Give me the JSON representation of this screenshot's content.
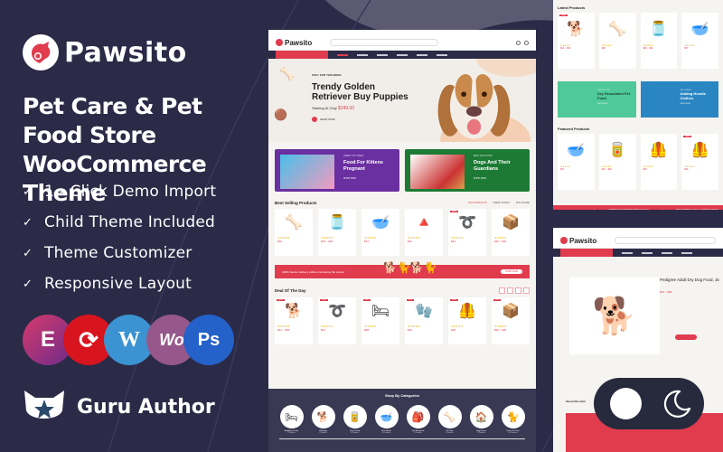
{
  "brand": {
    "name": "Pawsito",
    "logo_icon": "dog-cat-logo-icon"
  },
  "headline": {
    "line1": "Pet Care & Pet Food Store",
    "line2": "WooCommerce Theme"
  },
  "features": [
    "1 - Click Demo Import",
    "Child Theme Included",
    "Theme Customizer",
    "Responsive Layout"
  ],
  "badges": [
    {
      "name": "elementor",
      "glyph": "E",
      "color": "#92003b"
    },
    {
      "name": "revolution-slider",
      "glyph": "⟳",
      "color": "#e20a16"
    },
    {
      "name": "wordpress",
      "glyph": "W",
      "color": "#3b93d1"
    },
    {
      "name": "woocommerce",
      "glyph": "Wo",
      "color": "#96588a"
    },
    {
      "name": "photoshop",
      "glyph": "Ps",
      "color": "#2461c9"
    }
  ],
  "author": {
    "label": "Guru Author"
  },
  "mockup": {
    "logo": "Pawsito",
    "hero": {
      "kicker": "ONLY FOR THIS WEEK",
      "title": "Trendy Golden Retriever Buy Puppies",
      "price_label": "Starting At Only",
      "price": "$249.00",
      "button": "SHOP NOW"
    },
    "promos": [
      {
        "kicker": "GREAT CAT TREAT",
        "title": "Food For Kittens Pregnant",
        "button": "SHOP NOW",
        "color": "#6a2fa0"
      },
      {
        "kicker": "BEST DOG FOOD",
        "title": "Dogs And Their Guardians",
        "button": "SHOP NOW",
        "color": "#1d7a34"
      }
    ],
    "best_selling": {
      "title": "Best Selling Products",
      "tabs": [
        "DOG PRODUCTS",
        "FRESH FOODS",
        "DOG HOUSE"
      ],
      "products": [
        {
          "icon": "🦴",
          "price": "$30"
        },
        {
          "icon": "🫙",
          "price": "$25 – $30"
        },
        {
          "icon": "🥣",
          "price": "$37"
        },
        {
          "icon": "🔺",
          "price": "$42"
        },
        {
          "icon": "➰",
          "price": "$22",
          "sale": "SALE"
        },
        {
          "icon": "📦",
          "price": "$32 – $40"
        }
      ]
    },
    "strip": {
      "text": "100% Secure delivery without contacting the courier",
      "button": "SHOP NOW"
    },
    "deal": {
      "title": "Deal Of The Day",
      "products": [
        {
          "icon": "🐕",
          "price": "$12 – $30",
          "sale": "-10%"
        },
        {
          "icon": "➰",
          "price": "$22",
          "sale": "-15%"
        },
        {
          "icon": "🛏",
          "price": "$28",
          "sale": "-8%"
        },
        {
          "icon": "🧤",
          "price": "$19",
          "sale": "-5%"
        },
        {
          "icon": "🦺",
          "price": "$48",
          "sale": "-10%"
        },
        {
          "icon": "📦",
          "price": "$20 – $30",
          "sale": "-6%"
        }
      ]
    },
    "categories": {
      "title": "Shop By Categories",
      "items": [
        {
          "name": "Bedding & Litter",
          "count": "3 Products",
          "icon": "🛏"
        },
        {
          "name": "Clothings",
          "count": "5 Products",
          "icon": "🐕"
        },
        {
          "name": "Fresh Food",
          "count": "4 Products",
          "icon": "🥫"
        },
        {
          "name": "Pets Bowls",
          "count": "10 Products",
          "icon": "🥣"
        },
        {
          "name": "Pet Backpack",
          "count": "3 Products",
          "icon": "🎒"
        },
        {
          "name": "Pet Toys",
          "count": "4 Products",
          "icon": "🦴"
        },
        {
          "name": "Dog House",
          "count": "3 Products",
          "icon": "🏠"
        },
        {
          "name": "Plush Cat Tree",
          "count": "10 Products",
          "icon": "🐈"
        }
      ]
    }
  },
  "right_top": {
    "latest_title": "Latest Products",
    "latest": [
      {
        "icon": "🐕",
        "price": "$12 – $30",
        "sale": "SALE"
      },
      {
        "icon": "🦴",
        "price": "$30"
      },
      {
        "icon": "🫙",
        "price": "$25 – $30"
      },
      {
        "icon": "🥣",
        "price": "$37"
      }
    ],
    "banners": [
      {
        "kicker": "FLAT 30% OFF",
        "title": "Dry Granulated Pet Food",
        "button": "SHOP NOW",
        "color": "#3fbf8a"
      },
      {
        "kicker": "BEST DEALS",
        "title": "Adidog Hoodie Clothes",
        "button": "SHOP NOW",
        "color": "#1f7cb8"
      }
    ],
    "featured_title": "Featured Products",
    "featured": [
      {
        "icon": "🥣",
        "price": "$37"
      },
      {
        "icon": "🥫",
        "price": "$10 – $20"
      },
      {
        "icon": "🦺",
        "price": "$15"
      },
      {
        "icon": "🦺",
        "price": "$48",
        "sale": "SALE"
      }
    ],
    "ticker": [
      "DISCOUNTS ON DOGGY",
      "CASHBACK ON MINIMUM ORDER OF $40",
      "FREE SHIPPING FOR ALL ORDERS FROM $"
    ]
  },
  "right_bottom": {
    "logo": "Pawsito",
    "product_title": "Pedigree Adult Dry Dog Food, 1k",
    "price": "$34 – $38",
    "button": "ADD TO CART",
    "about_title": "About this item"
  },
  "theme_toggle": {
    "state": "dark",
    "icon": "moon-icon"
  }
}
